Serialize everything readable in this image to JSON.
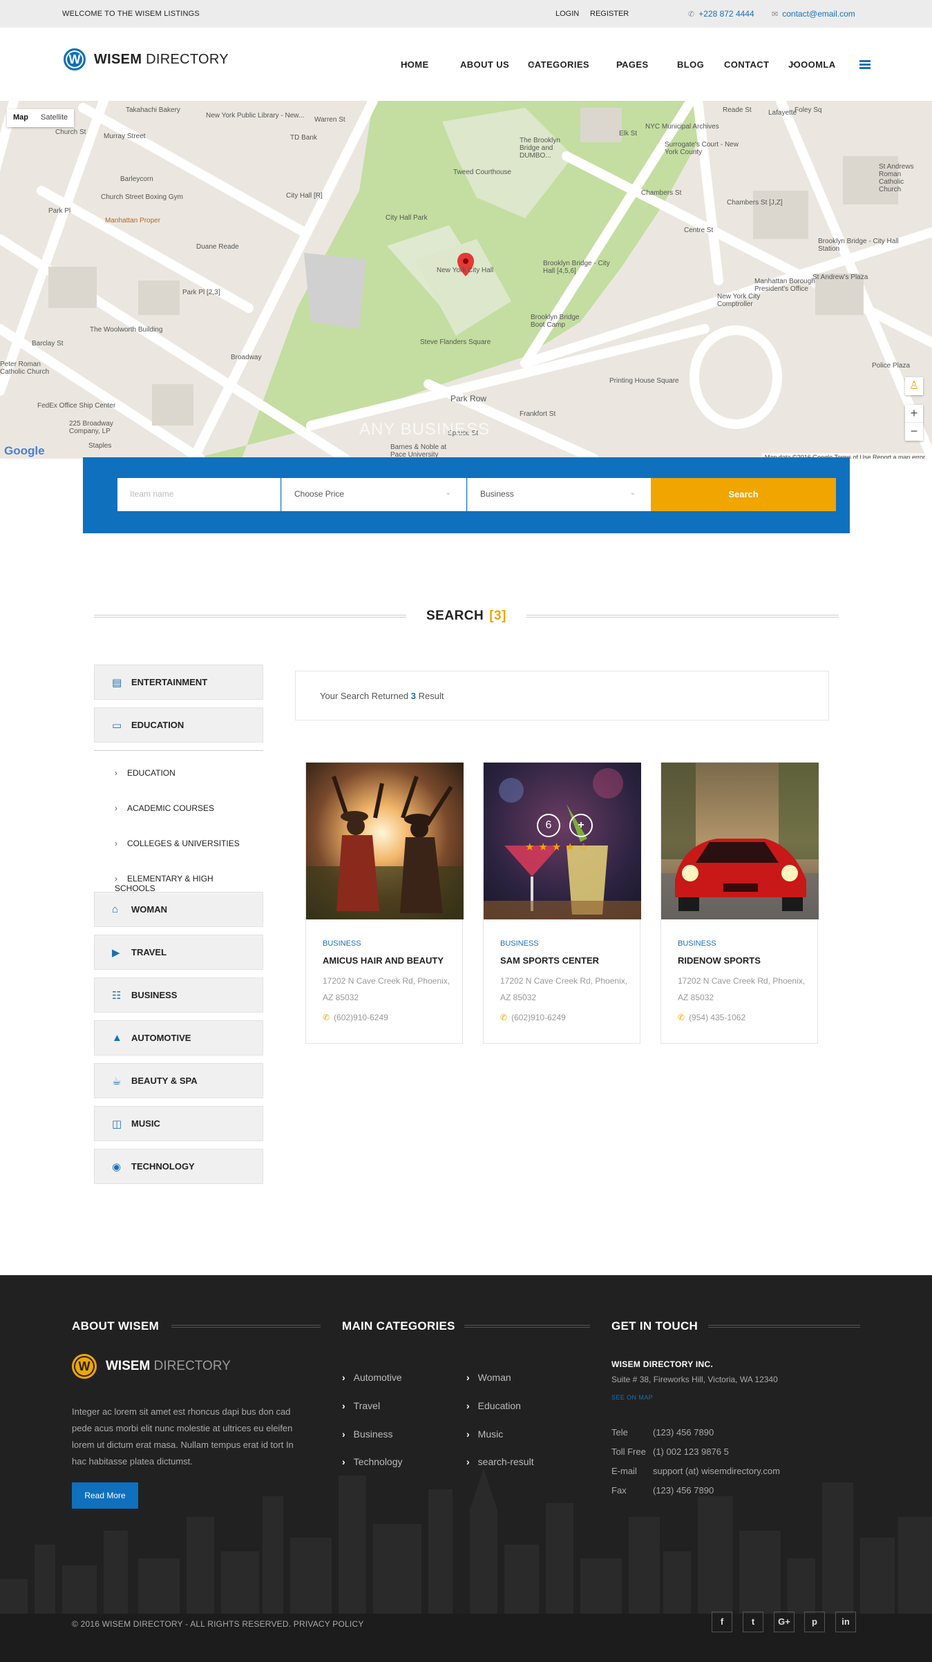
{
  "topbar": {
    "welcome": "WELCOME TO THE WISEM LISTINGS",
    "login": "LOGIN",
    "register": "REGISTER",
    "phone": "+228 872 4444",
    "email": "contact@email.com"
  },
  "brand": {
    "logo_letter": "W",
    "name_bold": "WISEM",
    "name_rest": " DIRECTORY"
  },
  "nav": {
    "items": [
      "HOME",
      "ABOUT US",
      "CATEGORIES",
      "PAGES",
      "BLOG",
      "CONTACT",
      "JOOOMLA"
    ]
  },
  "map": {
    "type_map": "Map",
    "type_satellite": "Satellite",
    "zoom_in": "+",
    "zoom_out": "−",
    "google": "Google",
    "footer": "Map data ©2016 Google   Terms of Use   Report a map error",
    "watermark": "ANY BUSINESS",
    "labels": [
      "Takahachi Bakery",
      "New York Public Library - New...",
      "TD Bank",
      "Warren St",
      "Murray Street",
      "Church St",
      "Barleycorn",
      "Church Street Boxing Gym",
      "Manhattan Proper",
      "Park Pl",
      "Duane Reade",
      "Park Pl [2,3]",
      "City Hall [R]",
      "City Hall Park",
      "Tweed Courthouse",
      "The Brooklyn Bridge and DUMBO...",
      "New York City Hall",
      "Brooklyn Bridge - City Hall [4,5,6]",
      "Brooklyn Bridge Boot Camp",
      "NYC Municipal Archives",
      "Surrogate's Court - New York County",
      "Chambers St",
      "Chambers St [J,Z]",
      "Centre St",
      "Brooklyn Bridge - City Hall Station",
      "Manhattan Borough President's Office",
      "New York City Comptroller",
      "The Woolworth Building",
      "Barclay St",
      "FedEx Office Ship Center",
      "225 Broadway Company, LP",
      "Staples",
      "Barnes & Noble at Pace University",
      "Broadway",
      "Steve Flanders Square",
      "Park Row",
      "Frankfort St",
      "Printing House Square",
      "St Andrews Roman Catholic Church",
      "Elk St",
      "Reade St",
      "Foley Sq",
      "Lafayette",
      "Peter Roman Catholic Church",
      "St Andrew's Plaza",
      "Police Plaza",
      "Spruce St"
    ]
  },
  "search": {
    "name_placeholder": "Iteam name",
    "price": "Choose Price",
    "category": "Business",
    "button": "Search"
  },
  "section": {
    "title": "SEARCH",
    "count": "[3]"
  },
  "sidebar": {
    "categories": [
      {
        "label": "ENTERTAINMENT",
        "icon": "money-icon"
      },
      {
        "label": "EDUCATION",
        "icon": "monitor-icon"
      }
    ],
    "subcategories": [
      "EDUCATION",
      "ACADEMIC COURSES",
      "COLLEGES & UNIVERSITIES",
      "ELEMENTARY & HIGH SCHOOLS"
    ],
    "more_categories": [
      {
        "label": "WOMAN",
        "icon": "home-icon"
      },
      {
        "label": "TRAVEL",
        "icon": "youtube-icon"
      },
      {
        "label": "BUSINESS",
        "icon": "sitemap-icon"
      },
      {
        "label": "AUTOMOTIVE",
        "icon": "graduation-cap-icon"
      },
      {
        "label": "BEAUTY & SPA",
        "icon": "coffee-icon"
      },
      {
        "label": "MUSIC",
        "icon": "book-icon"
      },
      {
        "label": "TECHNOLOGY",
        "icon": "globe-icon"
      }
    ]
  },
  "results": {
    "text_before": "Your Search Returned ",
    "count": "3",
    "text_after": " Result",
    "cards": [
      {
        "category": "BUSINESS",
        "name": "AMICUS HAIR AND BEAUTY",
        "address": "17202 N Cave Creek Rd, Phoenix, AZ 85032",
        "phone": "(602)910-6249"
      },
      {
        "category": "BUSINESS",
        "name": "SAM SPORTS CENTER",
        "address": "17202 N Cave Creek Rd, Phoenix, AZ 85032",
        "phone": "(602)910-6249",
        "overlay_count": "6",
        "overlay_plus": "+",
        "rating": 5
      },
      {
        "category": "BUSINESS",
        "name": "RIDENOW SPORTS",
        "address": "17202 N Cave Creek Rd, Phoenix, AZ 85032",
        "phone": "(954) 435-1062"
      }
    ]
  },
  "footer": {
    "about_title": "ABOUT WISEM",
    "about_logo_letter": "W",
    "about_logo_bold": "WISEM",
    "about_logo_rest": " DIRECTORY",
    "about_text": "Integer ac lorem sit amet est rhoncus dapi bus don cad pede acus morbi elit nunc molestie at ultrices eu eleifen lorem ut dictum erat masa. Nullam tempus erat id tort In hac habitasse platea dictumst.",
    "read_more": "Read More",
    "categories_title": "MAIN CATEGORIES",
    "categories_col1": [
      "Automotive",
      "Travel",
      "Business",
      "Technology"
    ],
    "categories_col2": [
      "Woman",
      "Education",
      "Music",
      "search-result"
    ],
    "contact_title": "GET IN TOUCH",
    "company": "WISEM DIRECTORY INC.",
    "address": "Suite # 38, Fireworks Hill, Victoria, WA 12340",
    "see_map": "SEE ON MAP",
    "contacts": [
      {
        "label": "Tele",
        "value": "(123) 456 7890"
      },
      {
        "label": "Toll Free",
        "value": "(1) 002 123 9876 5"
      },
      {
        "label": "E-mail",
        "value": "support (at) wisemdirectory.com"
      },
      {
        "label": "Fax",
        "value": "(123) 456 7890"
      }
    ],
    "copyright": "© 2016 WISEM DIRECTORY - ALL RIGHTS RESERVED. PRIVACY POLICY",
    "social": [
      {
        "icon": "facebook-icon",
        "glyph": "f"
      },
      {
        "icon": "twitter-icon",
        "glyph": "t"
      },
      {
        "icon": "google-plus-icon",
        "glyph": "G+"
      },
      {
        "icon": "pinterest-icon",
        "glyph": "p"
      },
      {
        "icon": "linkedin-icon",
        "glyph": "in"
      }
    ]
  },
  "colors": {
    "primary": "#0f70bd",
    "accent": "#f0a500",
    "footer_bg": "#212121"
  }
}
